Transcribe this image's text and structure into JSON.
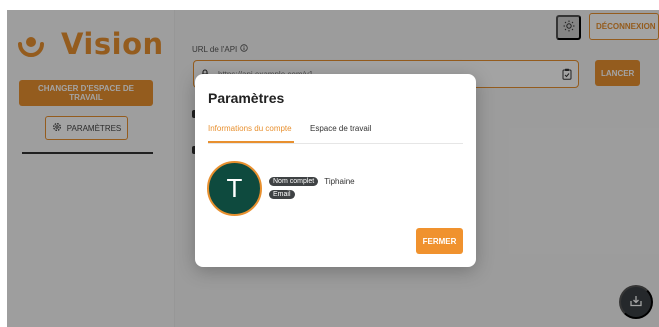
{
  "sidebar": {
    "logo_text": "Vision",
    "switch_workspace_label": "CHANGER D'ESPACE DE TRAVAIL",
    "settings_label": "PARAMÈTRES"
  },
  "header": {
    "logout_label": "DÉCONNEXION"
  },
  "main": {
    "url_label": "URL de l'API",
    "url_placeholder": "https://api.example.com/v1",
    "launch_label": "LANCER"
  },
  "modal": {
    "title": "Paramètres",
    "tabs": [
      {
        "label": "Informations du compte",
        "active": true
      },
      {
        "label": "Espace de travail",
        "active": false
      }
    ],
    "avatar_initial": "T",
    "fields": [
      {
        "label": "Nom complet",
        "value": "Tiphaine"
      },
      {
        "label": "Email",
        "value": ""
      }
    ],
    "close_label": "FERMER"
  },
  "colors": {
    "accent": "#e8902f",
    "avatar_bg": "#0e4a3e",
    "chip_bg": "#3f4244"
  }
}
